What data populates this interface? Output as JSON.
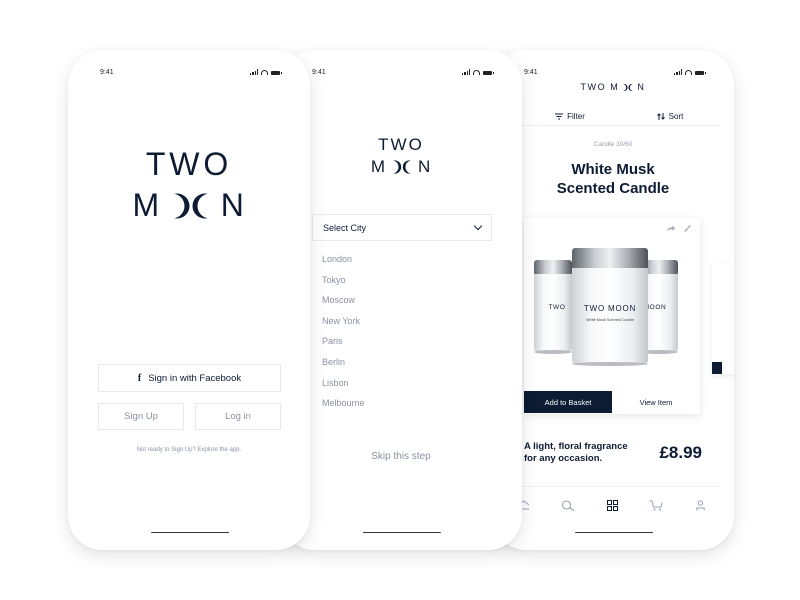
{
  "brand": {
    "line1": "TWO",
    "line2_left": "M",
    "line2_right": "N",
    "color": "#0d1b33"
  },
  "status": {
    "time": "9:41"
  },
  "signin": {
    "facebook_icon": "f",
    "facebook_label": "Sign in with Facebook",
    "signup_label": "Sign Up",
    "login_label": "Log in",
    "explore_text": "Not ready to Sign Up? Explore the app."
  },
  "city": {
    "select_label": "Select City",
    "cities": [
      "London",
      "Tokyo",
      "Moscow",
      "New York",
      "Paris",
      "Berlin",
      "Lisbon",
      "Melbourne"
    ],
    "skip_label": "Skip this step"
  },
  "product": {
    "filter_label": "Filter",
    "sort_label": "Sort",
    "category": "Candle 30/60",
    "title_line1": "White Musk",
    "title_line2": "Scented Candle",
    "jar_brand": "TWO MOON",
    "jar_brand_left": "TWO",
    "jar_brand_right": "MOON",
    "jar_subtitle": "White Musk Scented Candle",
    "add_to_basket": "Add to Basket",
    "view_item": "View Item",
    "description_line1": "A light, floral fragrance",
    "description_line2": "for any occasion.",
    "price": "£8.99"
  },
  "tabs": [
    "home-icon",
    "search-icon",
    "grid-icon",
    "basket-icon",
    "profile-icon"
  ]
}
